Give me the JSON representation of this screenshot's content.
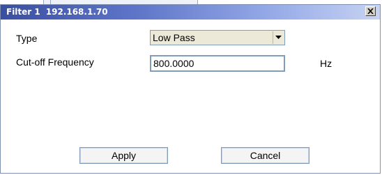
{
  "dialog": {
    "title": "Filter 1",
    "ip": "192.168.1.70"
  },
  "form": {
    "type_label": "Type",
    "type_value": "Low Pass",
    "cutoff_label": "Cut-off Frequency",
    "cutoff_value": "800.0000",
    "cutoff_unit": "Hz"
  },
  "buttons": {
    "apply_label": "Apply",
    "cancel_label": "Cancel"
  },
  "icons": {
    "close": "close-icon",
    "dropdown": "chevron-down-icon"
  },
  "colors": {
    "titlebar_start": "#3b4fa0",
    "titlebar_end": "#c7d3f3",
    "field_border": "#7f9db9"
  }
}
